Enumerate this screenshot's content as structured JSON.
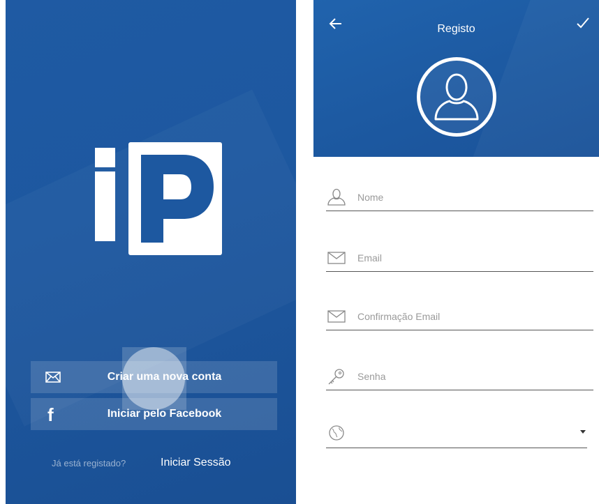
{
  "left": {
    "logo": "iP",
    "create_account_label": "Criar uma nova conta",
    "facebook_label": "Iniciar pelo Facebook",
    "already_registered": "Já está registado?",
    "sign_in_label": "Iniciar Sessão"
  },
  "right": {
    "title": "Registo",
    "fields": [
      {
        "placeholder": "Nome",
        "icon": "user-icon"
      },
      {
        "placeholder": "Email",
        "icon": "mail-icon"
      },
      {
        "placeholder": "Confirmação Email",
        "icon": "mail-icon"
      },
      {
        "placeholder": "Senha",
        "icon": "key-icon"
      },
      {
        "placeholder": "",
        "icon": "globe-icon"
      }
    ]
  },
  "colors": {
    "primary_blue": "#1d58a0",
    "white": "#ffffff",
    "placeholder_gray": "#9a9a9a"
  }
}
